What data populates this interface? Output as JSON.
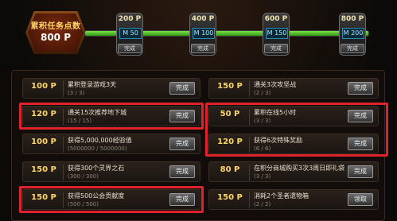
{
  "header": {
    "title": "累积任务点数",
    "points": "800 P"
  },
  "progress": {
    "fraction": 1.0
  },
  "milestones": [
    {
      "points": "200 P",
      "badge": "M 50",
      "button": "完成"
    },
    {
      "points": "400 P",
      "badge": "M 100",
      "button": "完成"
    },
    {
      "points": "600 P",
      "badge": "M 150",
      "button": "完成"
    },
    {
      "points": "800 P",
      "badge": "M 200",
      "button": "完成"
    }
  ],
  "tasks": [
    {
      "points": "100 P",
      "title": "累积登录游戏3天",
      "progress": "(3 / 3)",
      "button": "完成"
    },
    {
      "points": "150 P",
      "title": "通关3次攻坚战",
      "progress": "(2 / 3)",
      "button": "完成"
    },
    {
      "points": "120 P",
      "title": "通关15次推荐地下城",
      "progress": "(15 / 15)",
      "button": "完成"
    },
    {
      "points": "50 P",
      "title": "累积在线5小时",
      "progress": "(3 / 3)",
      "button": "完成"
    },
    {
      "points": "100 P",
      "title": "获得5,000,000经验值",
      "progress": "(5000000 / 5000000)",
      "button": "完成"
    },
    {
      "points": "120 P",
      "title": "获得6次特殊奖励",
      "progress": "(6 / 6)",
      "button": "完成"
    },
    {
      "points": "150 P",
      "title": "获得300个灵界之石",
      "progress": "(300 / 300)",
      "button": "完成"
    },
    {
      "points": "80 P",
      "title": "在积分商城购买3次3周日即礼袋",
      "progress": "(3 / 3)",
      "button": "完成"
    },
    {
      "points": "150 P",
      "title": "获得500公会贡献度",
      "progress": "(500 / 500)",
      "button": "完成"
    },
    {
      "points": "150 P",
      "title": "消耗2个圣者遗物箱",
      "progress": "(2 / 2)",
      "button": "领取"
    }
  ],
  "colors": {
    "highlight": "#e0222a",
    "points_gold": "#ffd66a",
    "bar_green": "#4fbf24"
  }
}
